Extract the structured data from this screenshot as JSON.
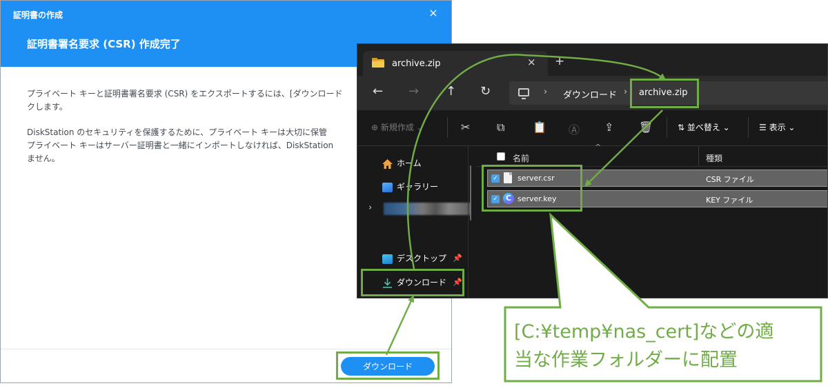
{
  "dialog": {
    "window_title": "証明書の作成",
    "close_symbol": "×",
    "heading": "証明書署名要求 (CSR) 作成完了",
    "para1_line1": "プライベート キーと証明書署名要求 (CSR) をエクスポートするには、[ダウンロード",
    "para1_line2": "クします。",
    "para2_line1": "DiskStation のセキュリティを保護するために、プライベート キーは大切に保管",
    "para2_line2": "プライベート キーはサーバー証明書と一緒にインポートしなければ、DiskStation",
    "para2_line3": "ません。",
    "download_button": "ダウンロード"
  },
  "explorer": {
    "tab_label": "archive.zip",
    "tab_close": "×",
    "tab_new": "+",
    "nav": {
      "back": "←",
      "forward": "→",
      "up": "↑",
      "refresh": "↻"
    },
    "breadcrumb": {
      "sep": "›",
      "downloads": "ダウンロード",
      "archive": "archive.zip"
    },
    "commands": {
      "new": "⊕ 新規作成 ⌄",
      "sort": "⇅ 並べ替え ⌄",
      "view": "☰ 表示 ⌄"
    },
    "icons": {
      "cut": "✂",
      "copy": "⧉",
      "paste": "📋",
      "rename": "Ⓐ",
      "share": "⇪",
      "delete": "🗑"
    },
    "sidebar": {
      "expand": "›",
      "pin": "📌",
      "items": [
        "ホーム",
        "ギャラリー",
        "デスクトップ",
        "ダウンロード"
      ]
    },
    "columns": {
      "name": "名前",
      "type": "種類",
      "sort_caret": "^"
    },
    "files": [
      {
        "name": "server.csr",
        "type": "CSR ファイル",
        "check": "✓"
      },
      {
        "name": "server.key",
        "type": "KEY ファイル",
        "check": "✓",
        "icon_letter": "C"
      }
    ]
  },
  "annotation": {
    "callout_line1": "[C:¥temp¥nas_cert]などの適",
    "callout_line2": "当な作業フォルダーに配置",
    "color": "#70ad47"
  }
}
